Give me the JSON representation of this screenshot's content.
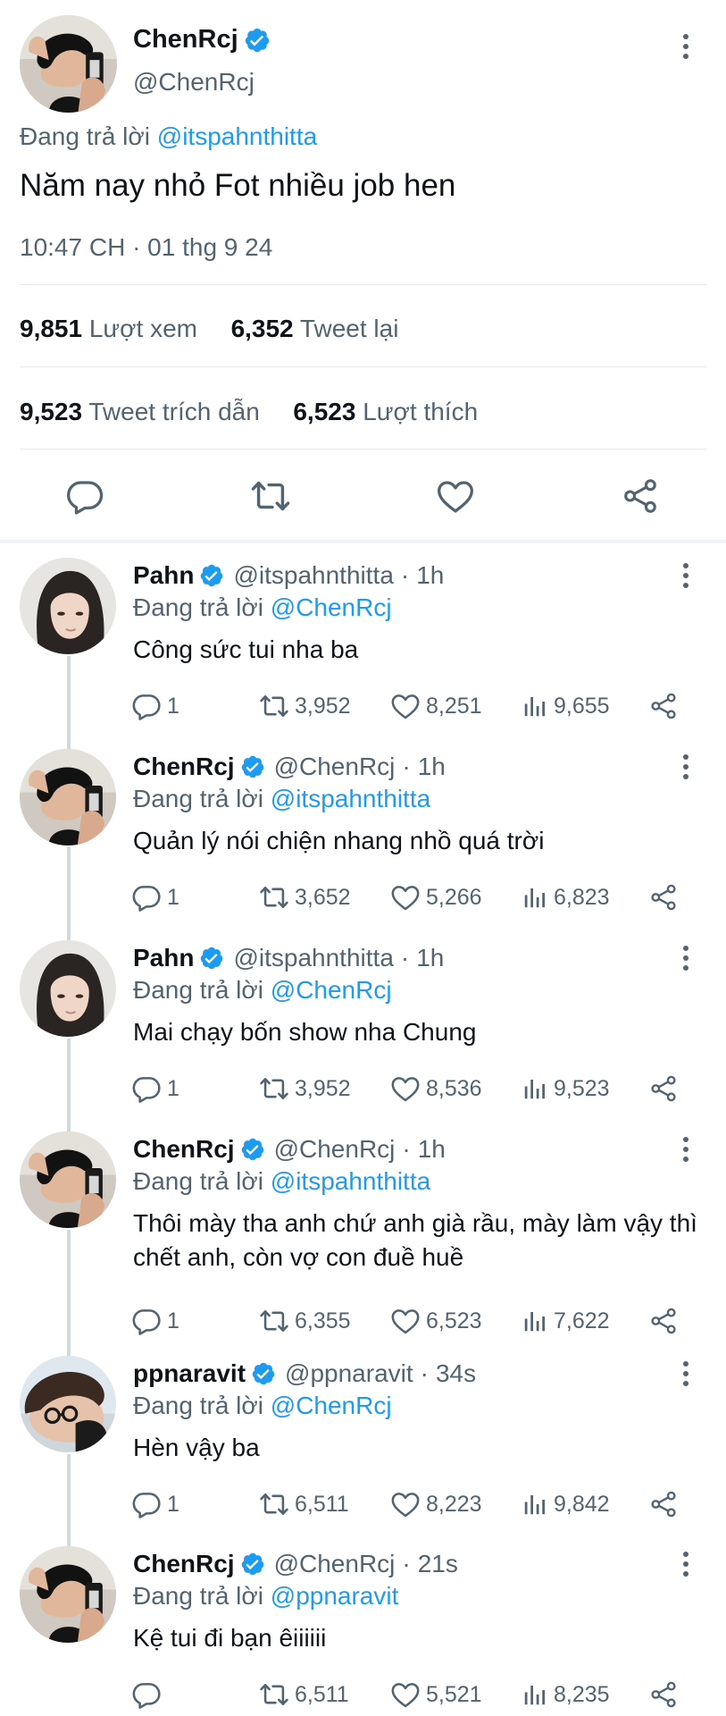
{
  "main_tweet": {
    "author_name": "ChenRcj",
    "author_handle": "@ChenRcj",
    "reply_prefix": "Đang trả lời",
    "reply_to": "@itspahnthitta",
    "text": "Năm nay nhỏ Fot nhiều job hen",
    "timestamp": "10:47 CH · 01 thg 9 24",
    "stats": {
      "views_count": "9,851",
      "views_label": "Lượt xem",
      "retweets_count": "6,352",
      "retweets_label": "Tweet lại",
      "quotes_count": "9,523",
      "quotes_label": "Tweet trích dẫn",
      "likes_count": "6,523",
      "likes_label": "Lượt thích"
    }
  },
  "colors": {
    "accent": "#1d9bf0",
    "text": "#0f1419",
    "secondary": "#536471",
    "divider": "#e6e9eb"
  },
  "icons": [
    "reply-icon",
    "retweet-icon",
    "like-icon",
    "share-icon",
    "views-icon",
    "more-icon",
    "verified-badge-icon"
  ],
  "replies": [
    {
      "name": "Pahn",
      "handle": "@itspahnthitta",
      "time": "1h",
      "reply_prefix": "Đang trả lời",
      "reply_to": "@ChenRcj",
      "text": "Công sức tui nha ba",
      "replies": "1",
      "retweets": "3,952",
      "likes": "8,251",
      "views": "9,655",
      "avatar": "pahn"
    },
    {
      "name": "ChenRcj",
      "handle": "@ChenRcj",
      "time": "1h",
      "reply_prefix": "Đang trả lời",
      "reply_to": "@itspahnthitta",
      "text": "Quản lý nói chiện nhang nhồ quá trời",
      "replies": "1",
      "retweets": "3,652",
      "likes": "5,266",
      "views": "6,823",
      "avatar": "chen"
    },
    {
      "name": "Pahn",
      "handle": "@itspahnthitta",
      "time": "1h",
      "reply_prefix": "Đang trả lời",
      "reply_to": "@ChenRcj",
      "text": "Mai chạy bốn show nha Chung",
      "replies": "1",
      "retweets": "3,952",
      "likes": "8,536",
      "views": "9,523",
      "avatar": "pahn"
    },
    {
      "name": "ChenRcj",
      "handle": "@ChenRcj",
      "time": "1h",
      "reply_prefix": "Đang trả lời",
      "reply_to": "@itspahnthitta",
      "text": "Thôi mày tha anh chứ anh già rầu, mày làm vậy thì chết anh, còn vợ con đuề huề",
      "replies": "1",
      "retweets": "6,355",
      "likes": "6,523",
      "views": "7,622",
      "avatar": "chen"
    },
    {
      "name": "ppnaravit",
      "handle": "@ppnaravit",
      "time": "34s",
      "reply_prefix": "Đang trả lời",
      "reply_to": "@ChenRcj",
      "text": "Hèn vậy ba",
      "replies": "1",
      "retweets": "6,511",
      "likes": "8,223",
      "views": "9,842",
      "avatar": "pp"
    },
    {
      "name": "ChenRcj",
      "handle": "@ChenRcj",
      "time": "21s",
      "reply_prefix": "Đang trả lời",
      "reply_to": "@ppnaravit",
      "text": "Kệ tui đi bạn êiiiiii",
      "replies": "",
      "retweets": "6,511",
      "likes": "5,521",
      "views": "8,235",
      "avatar": "chen"
    }
  ]
}
